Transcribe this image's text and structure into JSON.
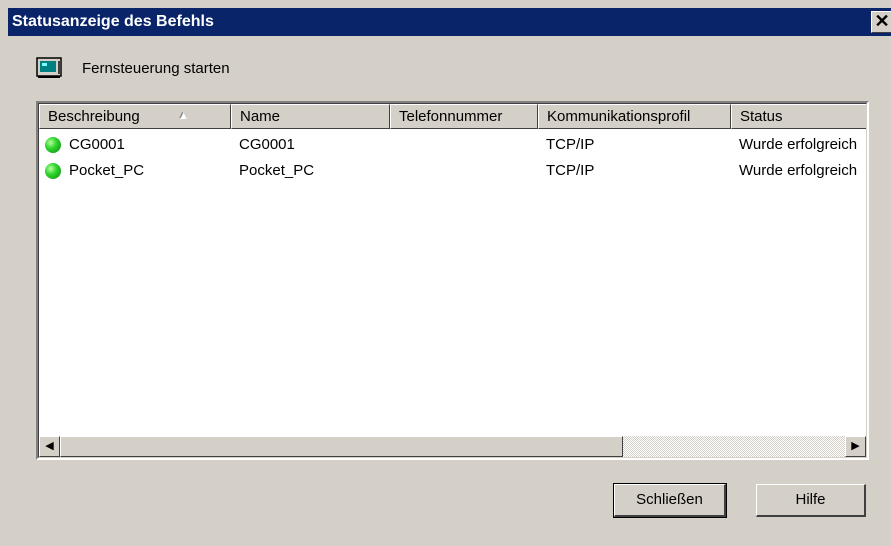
{
  "window": {
    "title": "Statusanzeige des Befehls",
    "close_glyph": "✕"
  },
  "header": {
    "icon": "monitor-icon",
    "label": "Fernsteuerung starten"
  },
  "list": {
    "columns": [
      {
        "label": "Beschreibung",
        "sorted": "ascending"
      },
      {
        "label": "Name"
      },
      {
        "label": "Telefonnummer"
      },
      {
        "label": "Kommunikationsprofil"
      },
      {
        "label": "Status"
      }
    ],
    "sort_glyph": "▲",
    "rows": [
      {
        "status_icon": "green-status-icon",
        "beschreibung": "CG0001",
        "name": "CG0001",
        "telefonnummer": "",
        "profil": "TCP/IP",
        "status": "Wurde erfolgreich"
      },
      {
        "status_icon": "green-status-icon",
        "beschreibung": "Pocket_PC",
        "name": "Pocket_PC",
        "telefonnummer": "",
        "profil": "TCP/IP",
        "status": "Wurde erfolgreich"
      }
    ]
  },
  "scrollbar": {
    "left_glyph": "◀",
    "right_glyph": "▶"
  },
  "buttons": {
    "close_label": "Schließen",
    "help_label": "Hilfe"
  },
  "colors": {
    "titlebar": "#0a246a",
    "face": "#d4d0c8",
    "status_ok": "#2fd42f"
  }
}
